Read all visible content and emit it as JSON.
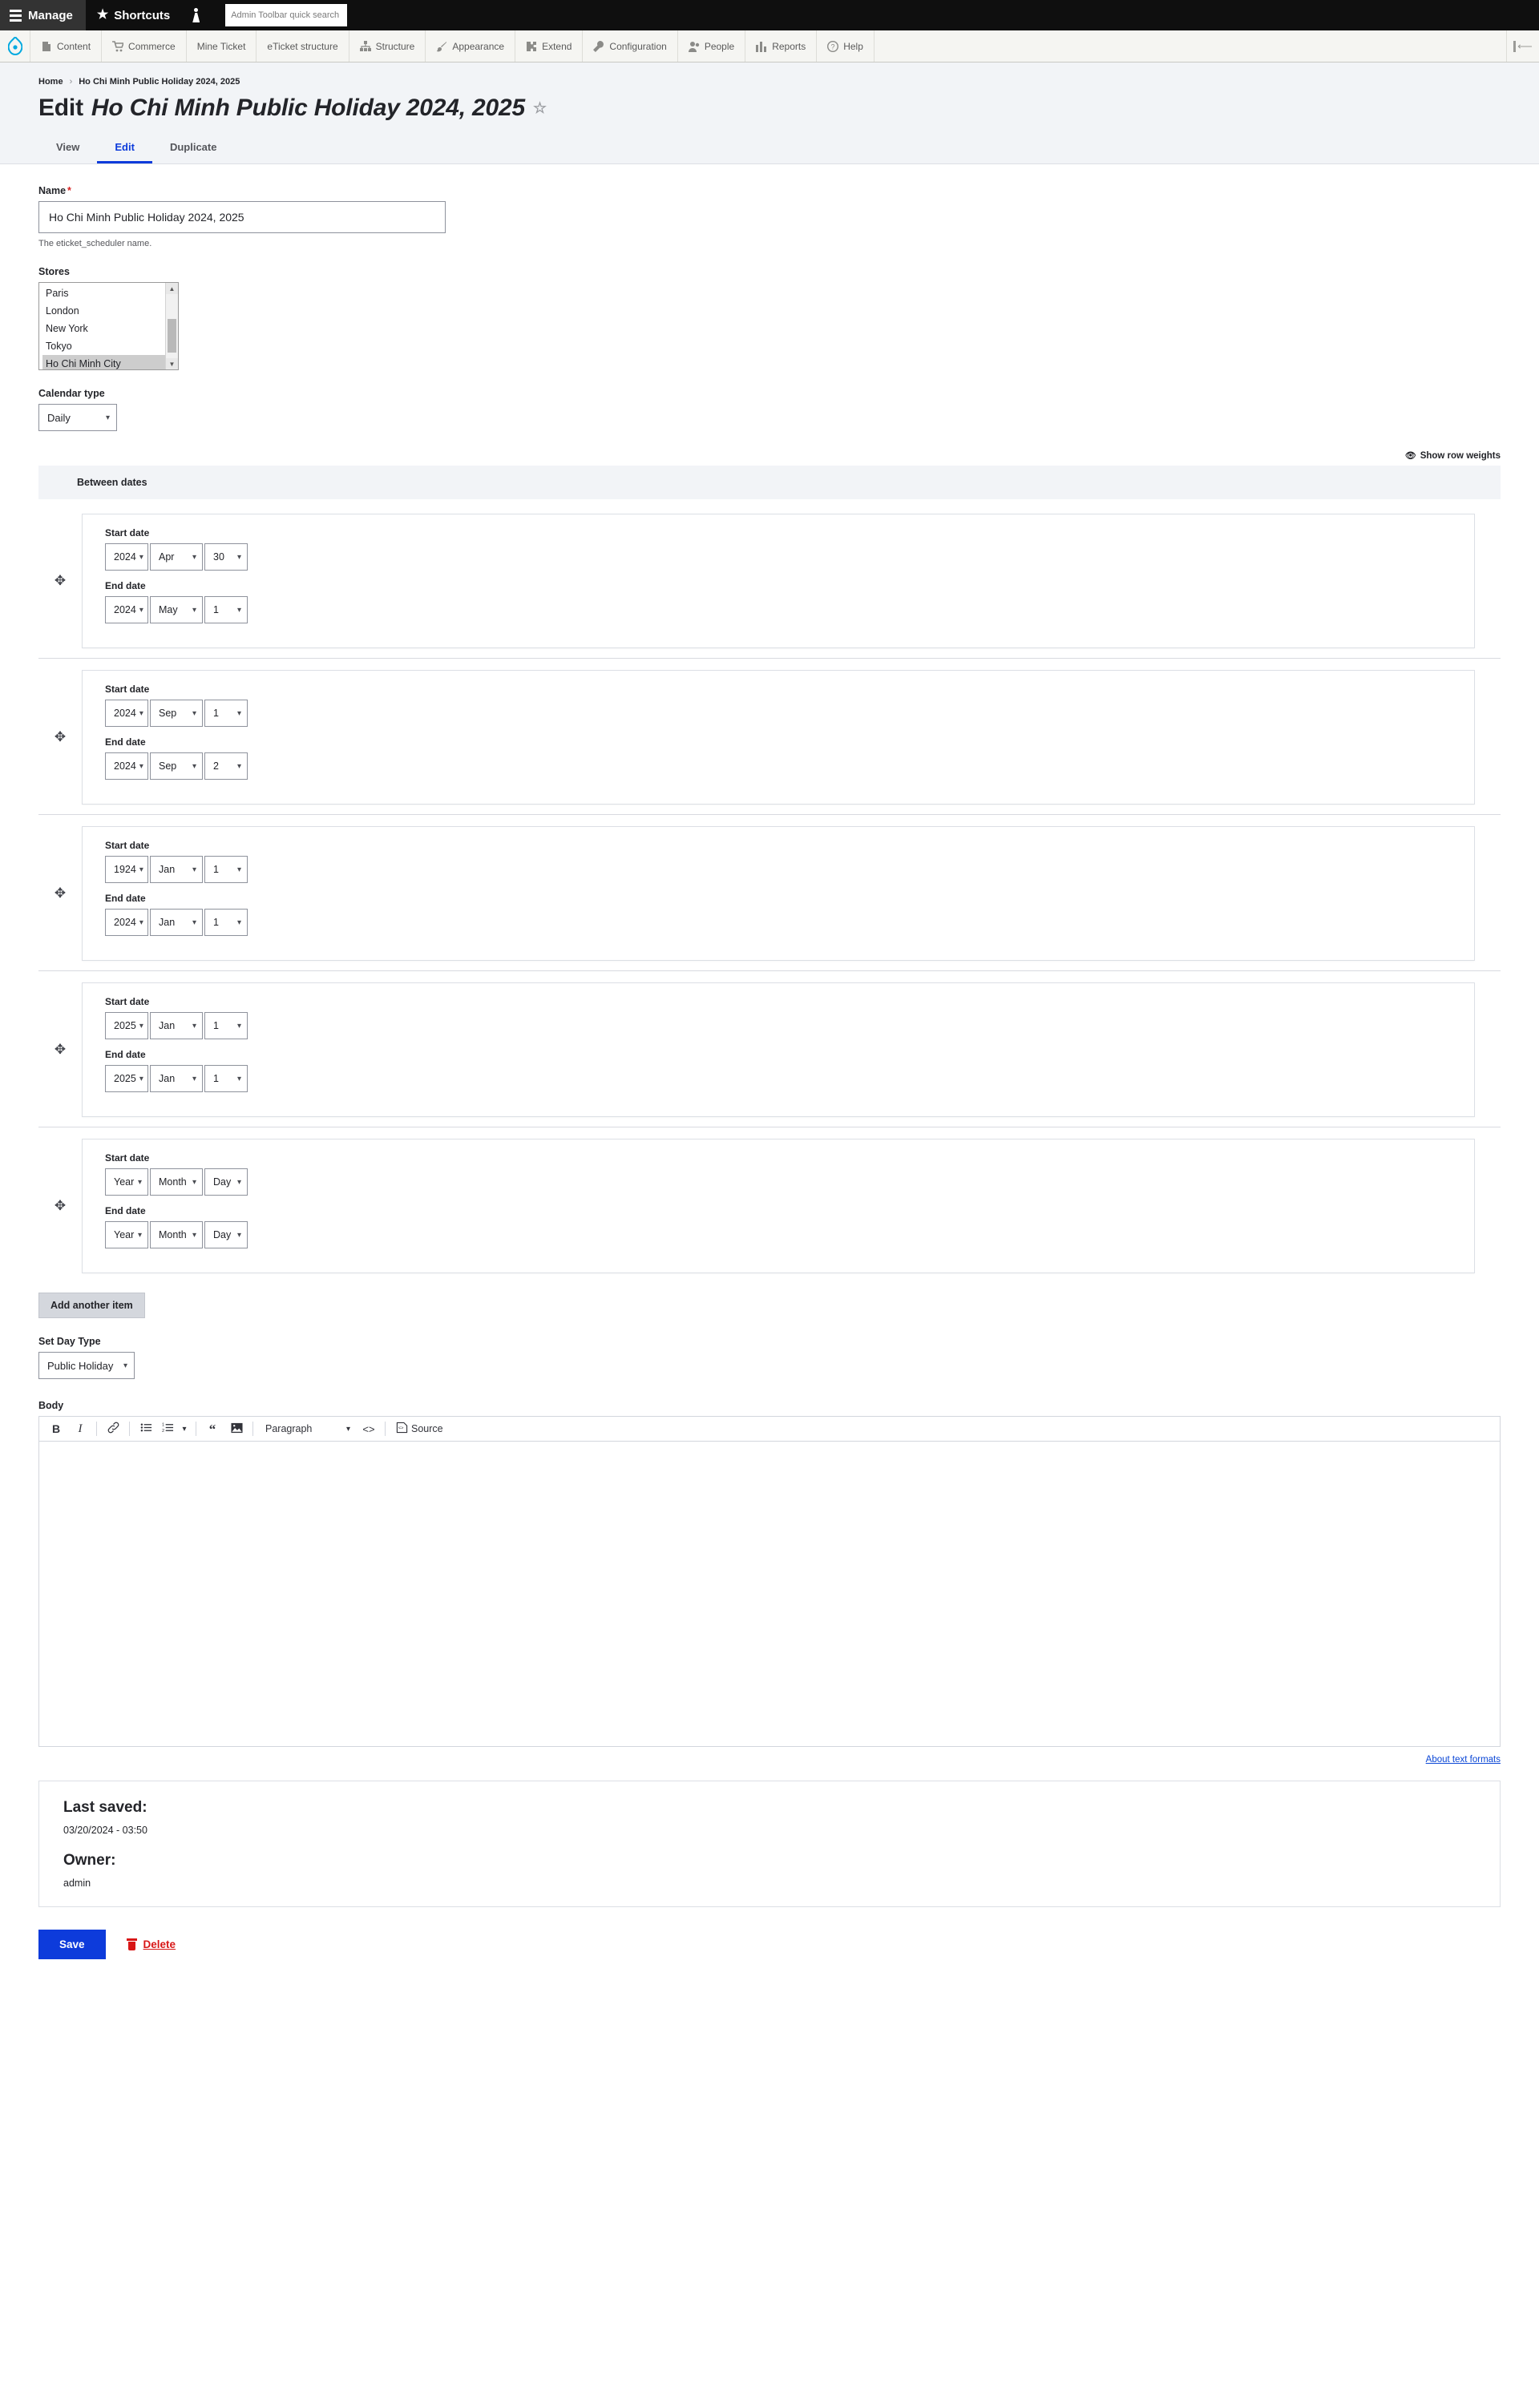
{
  "admin_toolbar": {
    "manage_label": "Manage",
    "shortcuts_label": "Shortcuts",
    "user_icon": "person-icon",
    "search_placeholder": "Admin Toolbar quick search",
    "menu": [
      {
        "label": "Content",
        "icon": "file-icon"
      },
      {
        "label": "Commerce",
        "icon": "cart-icon"
      },
      {
        "label": "Mine Ticket",
        "icon": ""
      },
      {
        "label": "eTicket structure",
        "icon": ""
      },
      {
        "label": "Structure",
        "icon": "sitemap-icon"
      },
      {
        "label": "Appearance",
        "icon": "paintbrush-icon"
      },
      {
        "label": "Extend",
        "icon": "puzzle-icon"
      },
      {
        "label": "Configuration",
        "icon": "wrench-icon"
      },
      {
        "label": "People",
        "icon": "people-icon"
      },
      {
        "label": "Reports",
        "icon": "bars-icon"
      },
      {
        "label": "Help",
        "icon": "question-icon"
      }
    ],
    "collapse_icon": "collapse-left-icon"
  },
  "breadcrumb": {
    "home": "Home",
    "separator": "›",
    "current": "Ho Chi Minh Public Holiday 2024, 2025"
  },
  "page": {
    "title_prefix": "Edit",
    "title_entity": "Ho Chi Minh Public Holiday 2024, 2025",
    "star_icon": "star-outline-icon"
  },
  "tabs": [
    {
      "label": "View",
      "active": false
    },
    {
      "label": "Edit",
      "active": true
    },
    {
      "label": "Duplicate",
      "active": false
    }
  ],
  "form": {
    "name": {
      "label": "Name",
      "required_marker": "*",
      "value": "Ho Chi Minh Public Holiday 2024, 2025",
      "description": "The eticket_scheduler name."
    },
    "stores": {
      "label": "Stores",
      "options": [
        "Paris",
        "London",
        "New York",
        "Tokyo",
        "Ho Chi Minh City"
      ],
      "selected": "Ho Chi Minh City"
    },
    "calendar_type": {
      "label": "Calendar type",
      "value": "Daily"
    },
    "show_row_weights": {
      "label": "Show row weights",
      "icon": "eye-icon"
    },
    "between_dates": {
      "legend": "Between dates",
      "start_label": "Start date",
      "end_label": "End date",
      "drag_icon": "drag-move-icon",
      "rows": [
        {
          "start": {
            "year": "2024",
            "month": "Apr",
            "day": "30"
          },
          "end": {
            "year": "2024",
            "month": "May",
            "day": "1"
          }
        },
        {
          "start": {
            "year": "2024",
            "month": "Sep",
            "day": "1"
          },
          "end": {
            "year": "2024",
            "month": "Sep",
            "day": "2"
          }
        },
        {
          "start": {
            "year": "1924",
            "month": "Jan",
            "day": "1"
          },
          "end": {
            "year": "2024",
            "month": "Jan",
            "day": "1"
          }
        },
        {
          "start": {
            "year": "2025",
            "month": "Jan",
            "day": "1"
          },
          "end": {
            "year": "2025",
            "month": "Jan",
            "day": "1"
          }
        },
        {
          "start": {
            "year": "Year",
            "month": "Month",
            "day": "Day"
          },
          "end": {
            "year": "Year",
            "month": "Month",
            "day": "Day"
          }
        }
      ]
    },
    "add_another": "Add another item",
    "day_type": {
      "label": "Set Day Type",
      "value": "Public Holiday"
    },
    "body": {
      "label": "Body",
      "value": "",
      "toolbar": {
        "bold": "B",
        "italic": "I",
        "link_icon": "link-icon",
        "bulleted_icon": "bulleted-list-icon",
        "numbered_icon": "numbered-list-icon",
        "list_dropdown_icon": "chevron-down-icon",
        "quote_icon": "blockquote-icon",
        "image_icon": "image-icon",
        "paragraph_label": "Paragraph",
        "paragraph_chevron": "chevron-down-icon",
        "code_icon": "source-inline-icon",
        "source_icon": "source-editing-icon",
        "source_label": "Source"
      },
      "about_text_formats": "About text formats"
    }
  },
  "meta": {
    "last_saved_label": "Last saved:",
    "last_saved_value": "03/20/2024 - 03:50",
    "owner_label": "Owner:",
    "owner_value": "admin"
  },
  "actions": {
    "save": "Save",
    "delete": "Delete",
    "delete_icon": "trash-icon"
  },
  "colors": {
    "accent": "#0d3bdb",
    "danger": "#d81616",
    "header_bg": "#f2f4f7",
    "toolbar_bg": "#0f0f0f"
  }
}
